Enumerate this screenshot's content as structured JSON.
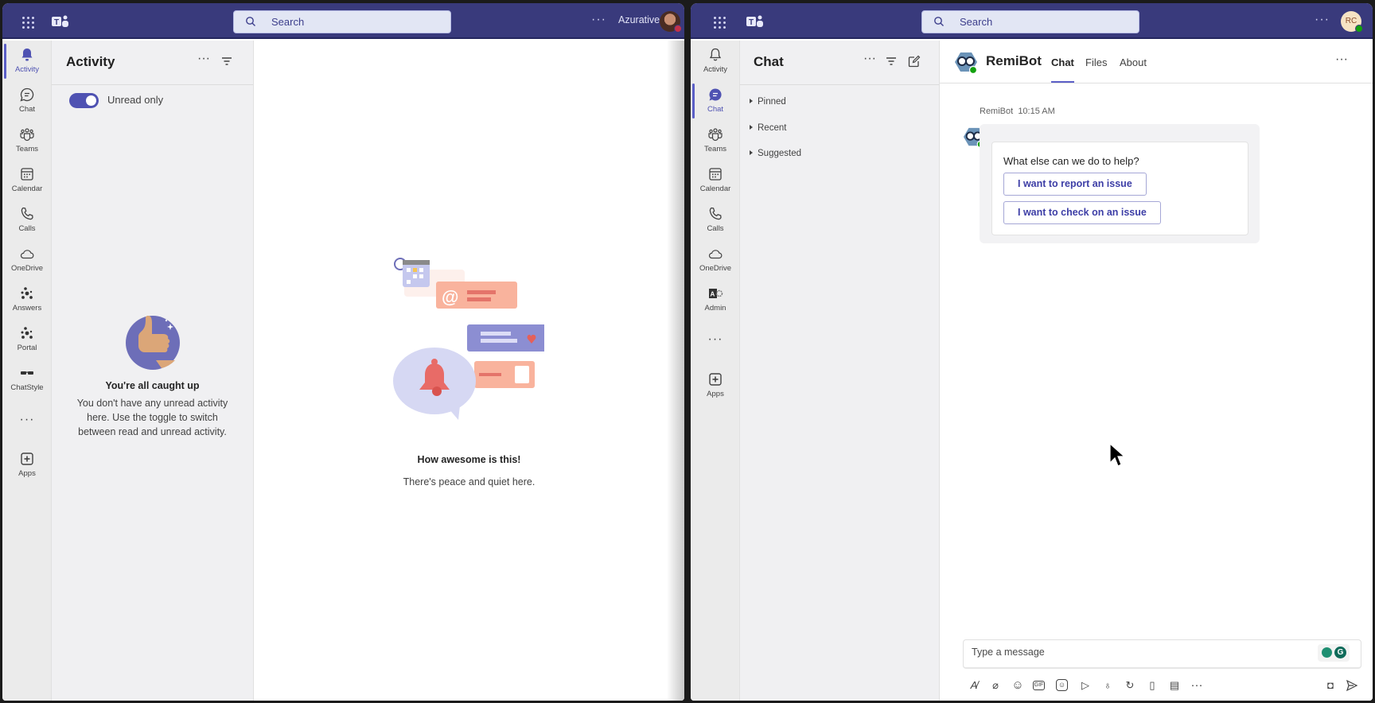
{
  "left_window": {
    "titlebar": {
      "search_placeholder": "Search",
      "more_label": "···",
      "user_name": "Azurative"
    },
    "rail": {
      "items": [
        {
          "label": "Activity",
          "icon": "bell-icon",
          "active": true
        },
        {
          "label": "Chat",
          "icon": "chat-icon"
        },
        {
          "label": "Teams",
          "icon": "teams-icon"
        },
        {
          "label": "Calendar",
          "icon": "calendar-icon"
        },
        {
          "label": "Calls",
          "icon": "phone-icon"
        },
        {
          "label": "OneDrive",
          "icon": "cloud-icon"
        },
        {
          "label": "Answers",
          "icon": "answers-icon"
        },
        {
          "label": "Portal",
          "icon": "portal-icon"
        },
        {
          "label": "ChatStyle",
          "icon": "glasses-icon"
        }
      ],
      "more_label": "···",
      "apps_label": "Apps"
    },
    "activity_pane": {
      "title": "Activity",
      "toggle_label": "Unread only",
      "toggle_on": true,
      "empty_title": "You're all caught up",
      "empty_body": "You don't have any unread activity here. Use the toggle to switch between read and unread activity."
    },
    "main": {
      "empty_title": "How awesome is this!",
      "empty_body": "There's peace and quiet here."
    }
  },
  "right_window": {
    "titlebar": {
      "search_placeholder": "Search",
      "more_label": "···",
      "avatar_initials": "RC"
    },
    "rail": {
      "items": [
        {
          "label": "Activity",
          "icon": "bell-icon"
        },
        {
          "label": "Chat",
          "icon": "chat-icon",
          "active": true
        },
        {
          "label": "Teams",
          "icon": "teams-icon"
        },
        {
          "label": "Calendar",
          "icon": "calendar-icon"
        },
        {
          "label": "Calls",
          "icon": "phone-icon"
        },
        {
          "label": "OneDrive",
          "icon": "cloud-icon"
        },
        {
          "label": "Admin",
          "icon": "admin-icon"
        }
      ],
      "more_label": "···",
      "apps_label": "Apps"
    },
    "chat_pane": {
      "title": "Chat",
      "sections": [
        "Pinned",
        "Recent",
        "Suggested"
      ]
    },
    "conversation": {
      "bot_name": "RemiBot",
      "tabs": [
        {
          "label": "Chat",
          "active": true
        },
        {
          "label": "Files"
        },
        {
          "label": "About"
        }
      ],
      "more_label": "···",
      "message": {
        "sender": "RemiBot",
        "time": "10:15 AM",
        "question": "What else can we do to help?",
        "buttons": [
          "I want to report an issue",
          "I want to check on an issue"
        ]
      },
      "composer": {
        "placeholder": "Type a message"
      },
      "toolbar_icons": [
        "format-icon",
        "attach-icon",
        "emoji-icon",
        "gif-icon",
        "sticker-icon",
        "forward-icon",
        "praise-icon",
        "loop-icon",
        "apps-icon",
        "notes-icon",
        "more-icon"
      ]
    }
  },
  "colors": {
    "titlebar": "#393a7c",
    "accent": "#5b5fc7",
    "rail_bg": "#ebebeb",
    "pane_bg": "#f0f0f2",
    "presence_available": "#13a10e",
    "presence_busy": "#c4314b"
  }
}
